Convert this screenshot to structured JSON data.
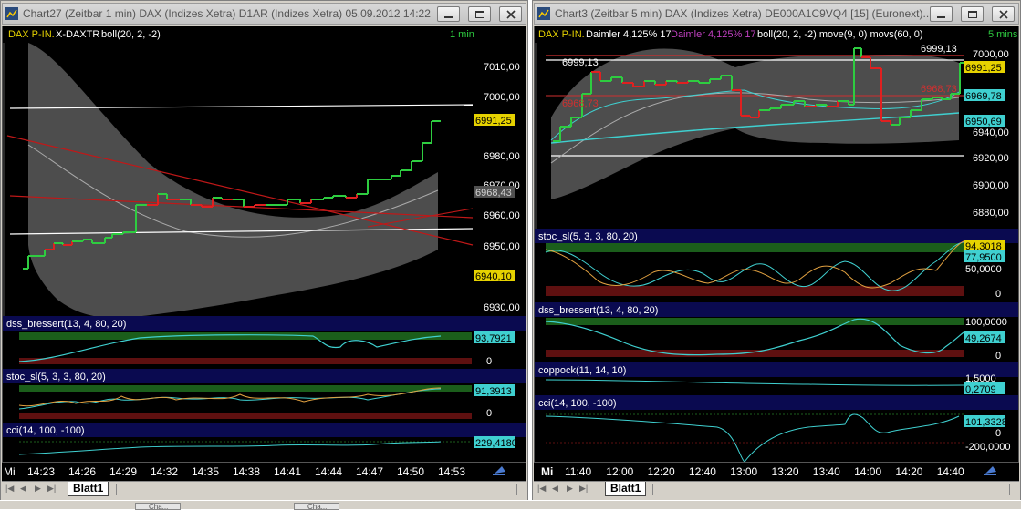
{
  "charts": [
    {
      "title": "Chart27 (Zeitbar 1 min)  DAX (Indizes Xetra) D1AR (Indizes Xetra) 05.09.2012 14:22 - 0...",
      "header": {
        "instrument": "DAX P-IN.",
        "second": "X-DAXTR",
        "indicator": "boll(20, 2, -2)",
        "interval": "1 min"
      },
      "price_scale": [
        "7010,00",
        "7000,00",
        "6980,00",
        "6970,00",
        "6960,00",
        "6950,00",
        "6930,00"
      ],
      "price_tags": {
        "last": "6991,25",
        "mid": "6968,43",
        "low": "6940,10"
      },
      "panels": [
        {
          "label": "dss_bressert(13, 4, 80, 20)",
          "value": "93,7921",
          "zero": "0"
        },
        {
          "label": "stoc_sl(5, 3, 3, 80, 20)",
          "value": "91,3913",
          "zero": "0"
        },
        {
          "label": "cci(14, 100, -100)",
          "value": "229,4180",
          "zero": ""
        }
      ],
      "x_first": "Mi",
      "x_labels": [
        "14:23",
        "14:26",
        "14:29",
        "14:32",
        "14:35",
        "14:38",
        "14:41",
        "14:44",
        "14:47",
        "14:50",
        "14:53"
      ],
      "sheet_tab": "Blatt1",
      "colors": {
        "bull": "#2ecc40",
        "bear": "#e02020",
        "boll": "#6e6e6e"
      }
    },
    {
      "title": "Chart3 (Zeitbar 5 min)  DAX (Indizes Xetra) DE000A1C9VQ4 [15] (Euronext)...",
      "header": {
        "instrument": "DAX P-IN.",
        "second": "Daimler  4,125% 17",
        "third": "Daimler  4,125% 17",
        "indicator": "boll(20, 2, -2)  move(9, 0)  movs(60, 0)",
        "interval": "5 mins"
      },
      "price_scale": [
        "7000,00",
        "6940,00",
        "6920,00",
        "6900,00",
        "6880,00"
      ],
      "price_tags": {
        "top": "6999,13",
        "last": "6991,25",
        "mid": "6969,78",
        "low": "6950,69",
        "red": "6968,73",
        "left_top": "6999,13",
        "left_red": "6968,73"
      },
      "panels": [
        {
          "label": "stoc_sl(5, 3, 3, 80, 20)",
          "value": "77,9500",
          "value2": "94,3018",
          "scale": "50,0000",
          "zero": "0"
        },
        {
          "label": "dss_bressert(13, 4, 80, 20)",
          "value": "49,2674",
          "scale": "100,0000",
          "zero": "0"
        },
        {
          "label": "coppock(11, 14, 10)",
          "value": "0,2709",
          "scale": "1,5000"
        },
        {
          "label": "cci(14, 100, -100)",
          "value": "101,3328",
          "scale": "-200,0000",
          "zero": "0"
        }
      ],
      "x_first": "Mi",
      "x_labels": [
        "11:40",
        "12:00",
        "12:20",
        "12:40",
        "13:00",
        "13:20",
        "13:40",
        "14:00",
        "14:20",
        "14:40"
      ],
      "sheet_tab": "Blatt1",
      "colors": {
        "bull": "#2ecc40",
        "bear": "#e02020",
        "boll": "#6e6e6e"
      }
    }
  ],
  "taskbar": [
    "Cha...",
    "Cha..."
  ]
}
